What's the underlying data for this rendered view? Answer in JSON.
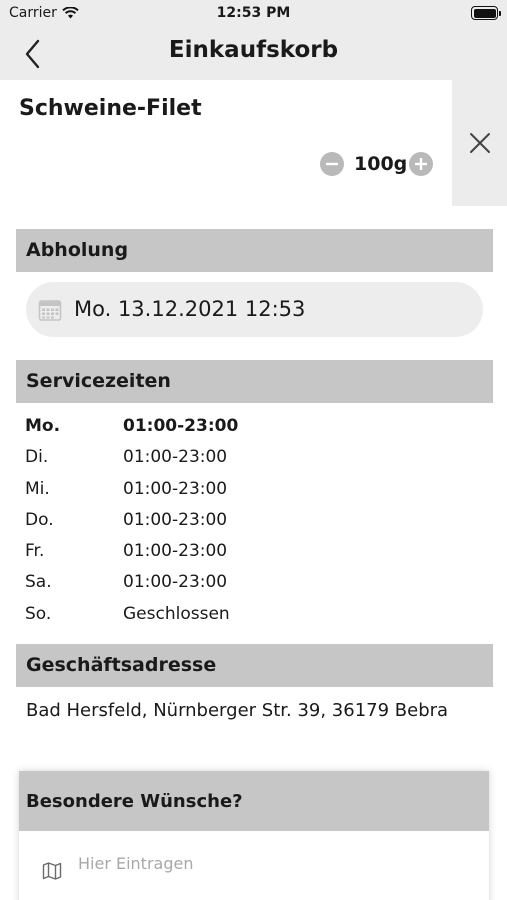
{
  "status_bar": {
    "carrier": "Carrier",
    "time": "12:53 PM",
    "icons": [
      "wifi-icon",
      "battery-icon"
    ]
  },
  "nav": {
    "title": "Einkaufskorb",
    "back_icon": "chevron-left-icon"
  },
  "cart_item": {
    "name": "Schweine-Filet",
    "quantity": "100g",
    "icons": [
      "minus-circle-icon",
      "plus-circle-icon",
      "close-icon"
    ]
  },
  "pickup": {
    "header": "Abholung",
    "datetime": "Mo. 13.12.2021 12:53",
    "icon": "calendar-icon"
  },
  "service_hours": {
    "header": "Servicezeiten",
    "rows": [
      {
        "day": "Mo.",
        "hours": "01:00-23:00"
      },
      {
        "day": "Di.",
        "hours": "01:00-23:00"
      },
      {
        "day": "Mi.",
        "hours": "01:00-23:00"
      },
      {
        "day": "Do.",
        "hours": "01:00-23:00"
      },
      {
        "day": "Fr.",
        "hours": "01:00-23:00"
      },
      {
        "day": "Sa.",
        "hours": "01:00-23:00"
      },
      {
        "day": "So.",
        "hours": "Geschlossen"
      }
    ]
  },
  "business_address": {
    "header": "Geschäftsadresse",
    "text": "Bad Hersfeld, Nürnberger Str. 39, 36179 Bebra"
  },
  "special_requests": {
    "header": "Besondere Wünsche?",
    "placeholder": "Hier Eintragen",
    "icon": "map-icon"
  },
  "colors": {
    "bar_background": "#ececec",
    "section_header": "#c6c6c6",
    "pill_background": "#ededed",
    "stepper_button": "#b9b9b9",
    "placeholder_text": "#a8a8a8"
  }
}
